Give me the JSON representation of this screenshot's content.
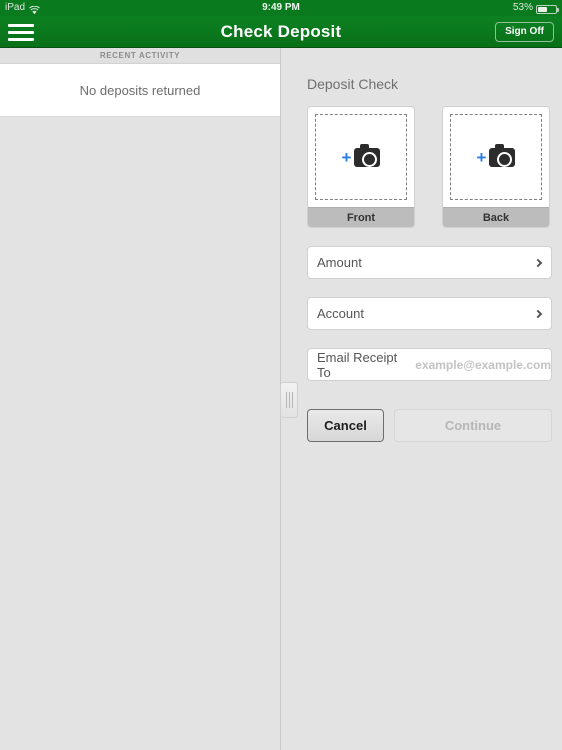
{
  "status_bar": {
    "device": "iPad",
    "wifi_icon": "wifi-icon",
    "time": "9:49 PM",
    "battery_percent": "53%",
    "battery_icon": "battery-icon"
  },
  "nav_bar": {
    "menu_icon": "hamburger-menu-icon",
    "title": "Check Deposit",
    "sign_off_label": "Sign Off"
  },
  "left_panel": {
    "section_header": "RECENT ACTIVITY",
    "empty_message": "No deposits returned"
  },
  "splitter": {
    "grip_icon": "drag-handle-icon"
  },
  "detail": {
    "title": "Deposit Check",
    "captures": [
      {
        "label": "Front",
        "plus_icon": "plus-icon",
        "camera_icon": "camera-icon"
      },
      {
        "label": "Back",
        "plus_icon": "plus-icon",
        "camera_icon": "camera-icon"
      }
    ],
    "fields": [
      {
        "label": "Amount",
        "chevron_icon": "chevron-right-icon"
      },
      {
        "label": "Account",
        "chevron_icon": "chevron-right-icon"
      }
    ],
    "email_field": {
      "label": "Email Receipt To",
      "placeholder": "example@example.com",
      "value": ""
    },
    "buttons": {
      "cancel_label": "Cancel",
      "continue_label": "Continue"
    }
  },
  "colors": {
    "brand_green": "#0a7a1f",
    "accent_blue": "#2a7de1",
    "panel_gray": "#e3e3e3",
    "label_gray": "#bcbcbc"
  }
}
